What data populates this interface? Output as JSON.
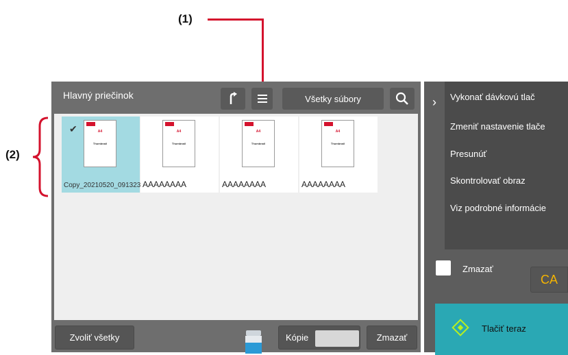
{
  "callouts": {
    "c1": "(1)",
    "c2": "(2)"
  },
  "panel": {
    "folder": "Hlavný priečinok",
    "filter_label": "Všetky súbory",
    "icons": {
      "back": "back-arrow-icon",
      "list": "list-view-icon",
      "search": "search-icon"
    }
  },
  "thumbnails": [
    {
      "name": "Copy_20210520_091323",
      "selected": true,
      "size": "A4",
      "caption": "Thumbnail"
    },
    {
      "name": "AAAAAAAA",
      "selected": false,
      "size": "A4",
      "caption": "Thumbnail"
    },
    {
      "name": "AAAAAAAA",
      "selected": false,
      "size": "A4",
      "caption": "Thumbnail"
    },
    {
      "name": "AAAAAAAA",
      "selected": false,
      "size": "A4",
      "caption": "Thumbnail"
    }
  ],
  "bottombar": {
    "select_all": "Zvoliť všetky",
    "copies": "Kópie",
    "delete": "Zmazať",
    "toner_icon": "toner-icon"
  },
  "right_panel": {
    "menu": [
      "Vykonať dávkovú tlač",
      "Zmeniť nastavenie tlače",
      "Presunúť",
      "Skontrolovať obraz",
      "Viz podrobné informácie"
    ],
    "delete_checkbox_label": "Zmazať",
    "ca_label": "CA",
    "print_now": "Tlačiť teraz"
  },
  "colors": {
    "accent": "#2aa8b4",
    "selected": "#a3dae2",
    "callout_line": "#d4122d",
    "ca": "#f5b400"
  }
}
